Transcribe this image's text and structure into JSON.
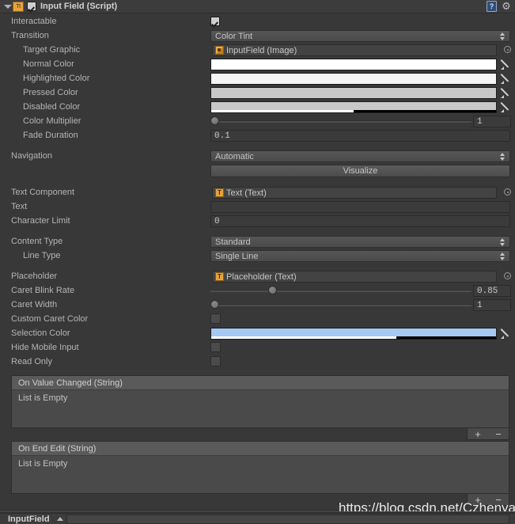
{
  "header": {
    "title": "Input Field (Script)",
    "enabled_checkbox": true,
    "script_icon_glyph": "TI",
    "help_icon": "help-book-icon",
    "gear_icon": "⚙"
  },
  "rows": {
    "interactable": {
      "label": "Interactable",
      "checked": true
    },
    "transition": {
      "label": "Transition",
      "value": "Color Tint"
    },
    "target_graphic": {
      "label": "Target Graphic",
      "value": "InputField (Image)"
    },
    "normal_color": {
      "label": "Normal Color",
      "color": "#FFFFFF",
      "alpha_pct": 100
    },
    "highlighted_color": {
      "label": "Highlighted Color",
      "color": "#F5F5F5",
      "alpha_pct": 100
    },
    "pressed_color": {
      "label": "Pressed Color",
      "color": "#C8C8C8",
      "alpha_pct": 100
    },
    "disabled_color": {
      "label": "Disabled Color",
      "color": "#C8C8C8",
      "alpha_pct": 50
    },
    "color_multiplier": {
      "label": "Color Multiplier",
      "value": "1",
      "knob_pct": 0
    },
    "fade_duration": {
      "label": "Fade Duration",
      "value": "0.1"
    },
    "navigation": {
      "label": "Navigation",
      "value": "Automatic"
    },
    "visualize": {
      "label": "Visualize"
    },
    "text_component": {
      "label": "Text Component",
      "value": "Text (Text)"
    },
    "text": {
      "label": "Text",
      "value": ""
    },
    "character_limit": {
      "label": "Character Limit",
      "value": "0"
    },
    "content_type": {
      "label": "Content Type",
      "value": "Standard"
    },
    "line_type": {
      "label": "Line Type",
      "value": "Single Line"
    },
    "placeholder": {
      "label": "Placeholder",
      "value": "Placeholder (Text)"
    },
    "caret_blink_rate": {
      "label": "Caret Blink Rate",
      "value": "0.85",
      "knob_pct": 22
    },
    "caret_width": {
      "label": "Caret Width",
      "value": "1",
      "knob_pct": 0
    },
    "custom_caret_color": {
      "label": "Custom Caret Color",
      "checked": false
    },
    "selection_color": {
      "label": "Selection Color",
      "color": "#A5C8F5",
      "alpha_pct": 65
    },
    "hide_mobile_input": {
      "label": "Hide Mobile Input",
      "checked": false
    },
    "read_only": {
      "label": "Read Only",
      "checked": false
    }
  },
  "events": [
    {
      "title": "On Value Changed (String)",
      "empty_text": "List is Empty",
      "add": "+",
      "remove": "−"
    },
    {
      "title": "On End Edit (String)",
      "empty_text": "List is Empty",
      "add": "+",
      "remove": "−"
    }
  ],
  "watermark": "https://blog.csdn.net/Czhenya",
  "bottom_bar": {
    "label": "InputField"
  }
}
